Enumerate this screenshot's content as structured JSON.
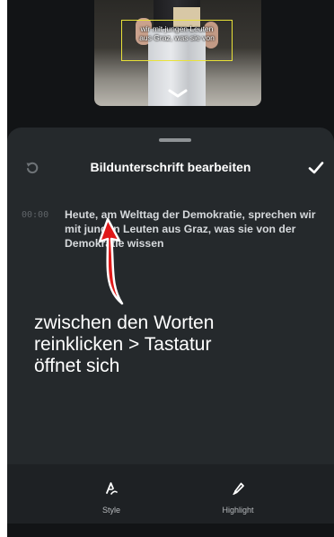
{
  "video": {
    "caption_preview_lines": [
      "wir mit jungen Leuten",
      "aus Graz, was sie von"
    ]
  },
  "sheet": {
    "title": "Bildunterschrift bearbeiten",
    "undo_icon": "undo-icon",
    "done_icon": "checkmark-icon"
  },
  "caption": {
    "timestamp": "00:00",
    "text": "Heute, am Welttag der Demokratie, sprechen wir mit jungen Leuten aus Graz, was sie von der Demokratie wissen"
  },
  "toolbar": {
    "style_label": "Style",
    "highlight_label": "Highlight"
  },
  "annotation": {
    "lines": [
      "zwischen den Worten",
      "reinklicken > Tastatur",
      "öffnet sich"
    ],
    "arrow_color": "#e01818"
  }
}
